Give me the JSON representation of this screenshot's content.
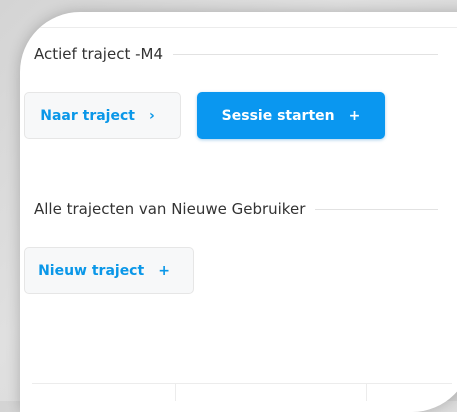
{
  "active_section": {
    "heading": "Actief traject -M4"
  },
  "actions": {
    "naar_traject_label": "Naar traject",
    "naar_traject_icon": "›",
    "sessie_starten_label": "Sessie starten",
    "sessie_starten_icon": "+"
  },
  "all_section": {
    "heading": "Alle trajecten van Nieuwe Gebruiker"
  },
  "create": {
    "nieuw_traject_label": "Nieuw traject",
    "nieuw_traject_icon": "+"
  },
  "colors": {
    "primary": "#0a97f0",
    "link": "#0a97e8",
    "heading_text": "#333333",
    "button_light_bg": "#f7f8f9"
  }
}
